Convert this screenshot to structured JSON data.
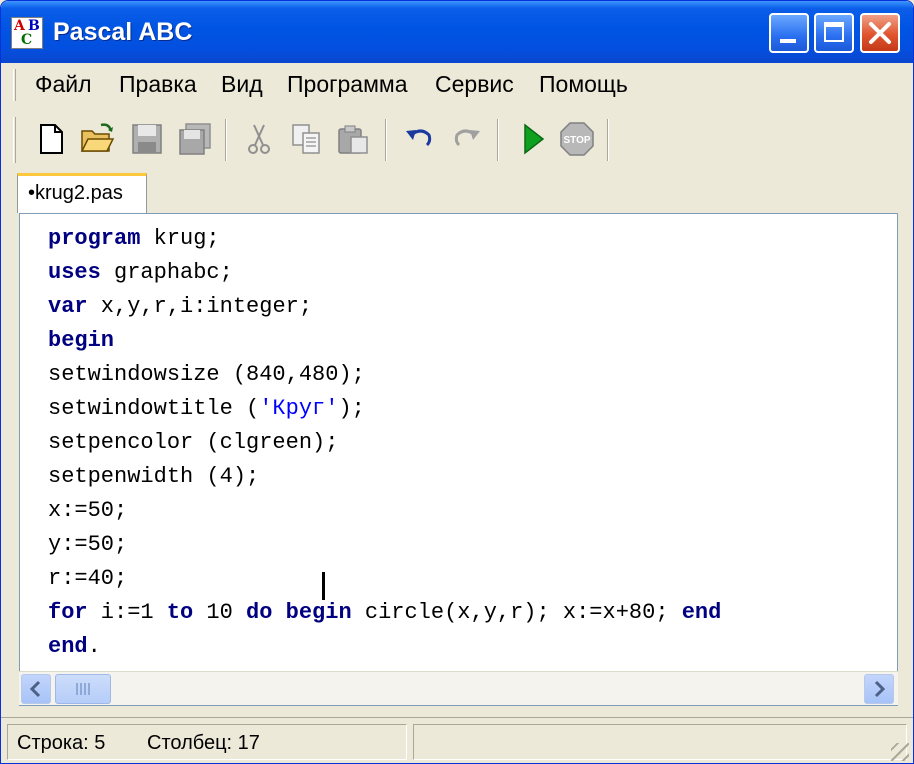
{
  "window": {
    "title": "Pascal ABC",
    "icon_letters": [
      "A",
      "B",
      "C"
    ],
    "icon": "pascal-abc-icon"
  },
  "menu": {
    "items": [
      "Файл",
      "Правка",
      "Вид",
      "Программа",
      "Сервис",
      "Помощь"
    ]
  },
  "toolbar": {
    "buttons": [
      "new-file-icon",
      "open-folder-icon",
      "save-icon",
      "save-all-icon",
      "cut-icon",
      "copy-icon",
      "paste-icon",
      "undo-icon",
      "redo-icon",
      "run-icon",
      "stop-icon"
    ],
    "stop_label": "STOP"
  },
  "tabs": [
    {
      "label": "•krug2.pas",
      "active": true
    }
  ],
  "editor": {
    "lines": [
      [
        {
          "t": "program",
          "k": true
        },
        {
          "t": " krug;"
        }
      ],
      [
        {
          "t": "uses",
          "k": true
        },
        {
          "t": " graphabc;"
        }
      ],
      [
        {
          "t": "var",
          "k": true
        },
        {
          "t": " x,y,r,i:integer;"
        }
      ],
      [
        {
          "t": "begin",
          "k": true
        }
      ],
      [
        {
          "t": "setwindowsize (840,480);"
        }
      ],
      [
        {
          "t": "setwindowtitle ("
        },
        {
          "t": "'Круг'",
          "s": true
        },
        {
          "t": ");"
        }
      ],
      [
        {
          "t": "setpencolor (clgreen);"
        }
      ],
      [
        {
          "t": "setpenwidth (4);"
        }
      ],
      [
        {
          "t": "x:=50;"
        }
      ],
      [
        {
          "t": "y:=50;"
        }
      ],
      [
        {
          "t": "r:=40;"
        }
      ],
      [
        {
          "t": "for",
          "k": true
        },
        {
          "t": " i:=1 "
        },
        {
          "t": "to",
          "k": true
        },
        {
          "t": " 10 "
        },
        {
          "t": "do",
          "k": true
        },
        {
          "t": " "
        },
        {
          "t": "begin",
          "k": true
        },
        {
          "t": " circle(x,y,r); x:=x+80; "
        },
        {
          "t": "end",
          "k": true
        }
      ],
      [
        {
          "t": "end",
          "k": true
        },
        {
          "t": "."
        }
      ]
    ]
  },
  "status": {
    "line_label": "Строка: 5",
    "column_label": "Столбец: 17"
  },
  "colors": {
    "keyword": "#000080",
    "string": "#0000ff",
    "titlebar": "#0054e3",
    "tab_accent": "#ffc83c"
  }
}
